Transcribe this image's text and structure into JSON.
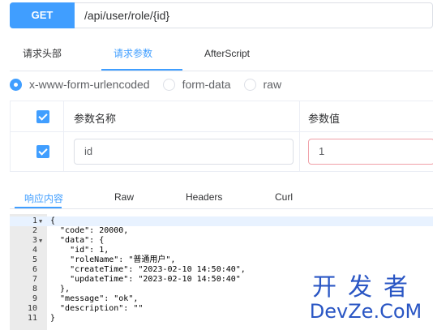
{
  "request": {
    "method": "GET",
    "url": "/api/user/role/{id}"
  },
  "tabs": [
    "请求头部",
    "请求参数",
    "AfterScript"
  ],
  "body_types": [
    {
      "label": "x-www-form-urlencoded",
      "checked": true
    },
    {
      "label": "form-data",
      "checked": false
    },
    {
      "label": "raw",
      "checked": false
    }
  ],
  "params": {
    "headers": {
      "name": "参数名称",
      "value": "参数值"
    },
    "rows": [
      {
        "name": "id",
        "value": "1",
        "checked": true
      }
    ]
  },
  "response_tabs": [
    "响应内容",
    "Raw",
    "Headers",
    "Curl"
  ],
  "response_lines": [
    "{",
    "  \"code\": 20000,",
    "  \"data\": {",
    "    \"id\": 1,",
    "    \"roleName\": \"普通用户\",",
    "    \"createTime\": \"2023-02-10 14:50:40\",",
    "    \"updateTime\": \"2023-02-10 14:50:40\"",
    "  },",
    "  \"message\": \"ok\",",
    "  \"description\": \"\"",
    "}"
  ],
  "watermark": {
    "line1": "开发者",
    "line2": "DevZe.CoM"
  },
  "colors": {
    "accent": "#409eff",
    "border": "#dcdfe6",
    "gutter": "#ebebeb"
  }
}
